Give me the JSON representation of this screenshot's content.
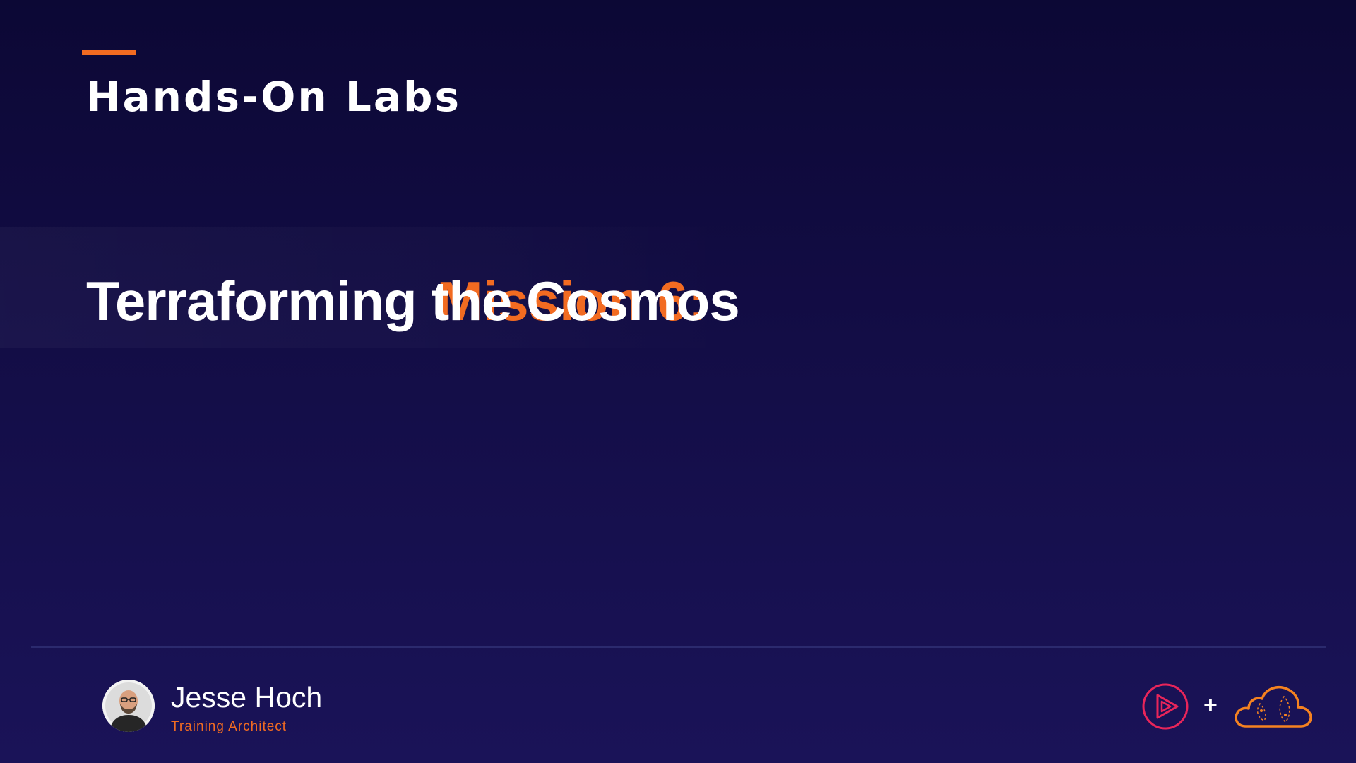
{
  "slide": {
    "section_title": "Hands-On Labs",
    "mission_prefix": "Mission 6: ",
    "mission_name": "Terraforming the Cosmos"
  },
  "presenter": {
    "name": "Jesse Hoch",
    "role": "Training Architect",
    "avatar_icon": "avatar-photo"
  },
  "logos": {
    "play_icon": "play-logo-icon",
    "plus": "+",
    "cloud_icon": "cloud-logo-icon"
  },
  "colors": {
    "background_top": "#0c0835",
    "background_bottom": "#1a1358",
    "accent": "#f26b21",
    "play_logo": "#e8255a",
    "cloud_logo": "#f58220",
    "divider": "#2b2a6e"
  }
}
